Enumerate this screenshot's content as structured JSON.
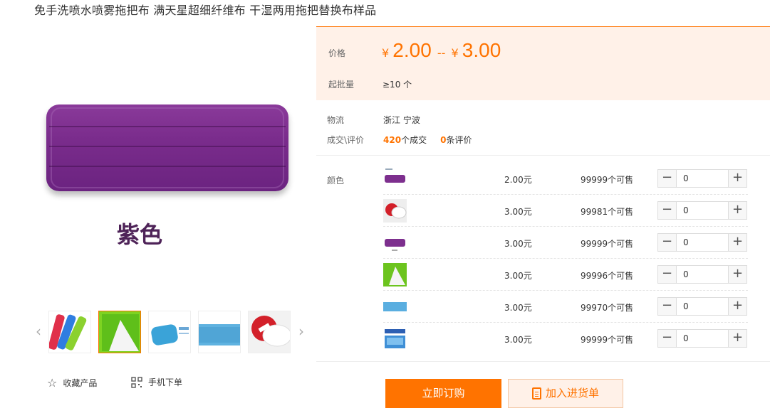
{
  "product": {
    "title": "免手洗喷水喷雾拖把布 满天星超细纤维布 干湿两用拖把替换布样品",
    "main_image_caption": "紫色"
  },
  "gallery": {
    "prev_icon": "‹",
    "next_icon": "›",
    "thumbnail_count": 5
  },
  "actions": {
    "favorite_label": "收藏产品",
    "mobile_order_label": "手机下单"
  },
  "price_panel": {
    "price_label": "价格",
    "currency": "¥",
    "price_low": "2.00",
    "separator": "--",
    "price_high": "3.00",
    "moq_label": "起批量",
    "moq_value": "≥10 个"
  },
  "logistics": {
    "label": "物流",
    "value": "浙江 宁波"
  },
  "deals": {
    "label": "成交\\评价",
    "count": "420",
    "count_suffix": "个成交",
    "reviews": "0",
    "reviews_suffix": "条评价"
  },
  "sku": {
    "label": "颜色",
    "rows": [
      {
        "price": "2.00元",
        "stock": "99999个可售",
        "qty": "0"
      },
      {
        "price": "3.00元",
        "stock": "99981个可售",
        "qty": "0"
      },
      {
        "price": "3.00元",
        "stock": "99999个可售",
        "qty": "0"
      },
      {
        "price": "3.00元",
        "stock": "99996个可售",
        "qty": "0"
      },
      {
        "price": "3.00元",
        "stock": "99970个可售",
        "qty": "0"
      },
      {
        "price": "3.00元",
        "stock": "99999个可售",
        "qty": "0"
      }
    ]
  },
  "buttons": {
    "buy_now": "立即订购",
    "add_to_cart": "加入进货单"
  },
  "colors": {
    "accent": "#ff7300",
    "price_bg": "#fff1e8"
  }
}
